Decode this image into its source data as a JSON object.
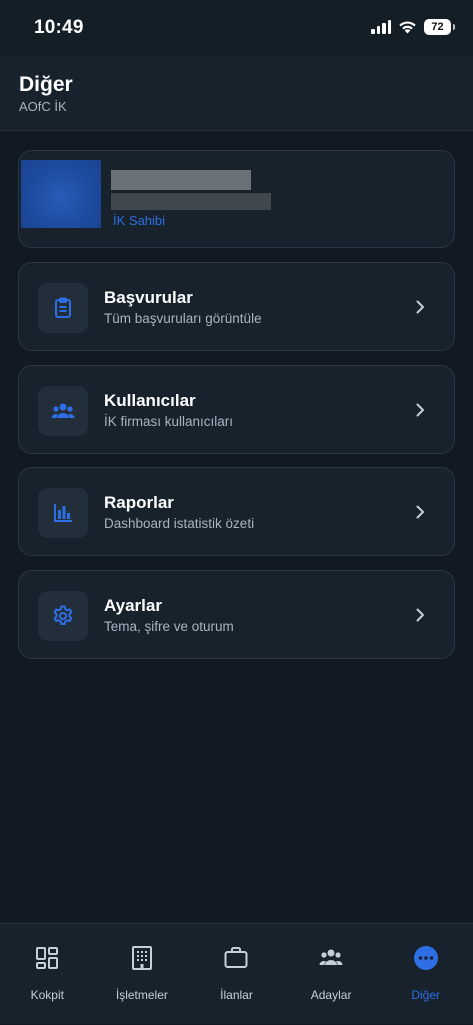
{
  "status_bar": {
    "time": "10:49",
    "battery": "72"
  },
  "header": {
    "title": "Diğer",
    "subtitle": "AOfC İK"
  },
  "profile": {
    "role": "İK Sahibi"
  },
  "menu": [
    {
      "title": "Başvurular",
      "desc": "Tüm başvuruları görüntüle",
      "icon": "clipboard-icon"
    },
    {
      "title": "Kullanıcılar",
      "desc": "İK firması kullanıcıları",
      "icon": "users-icon"
    },
    {
      "title": "Raporlar",
      "desc": "Dashboard istatistik özeti",
      "icon": "bar-chart-icon"
    },
    {
      "title": "Ayarlar",
      "desc": "Tema, şifre ve oturum",
      "icon": "gear-icon"
    }
  ],
  "tabs": [
    {
      "label": "Kokpit",
      "icon": "dashboard-icon"
    },
    {
      "label": "İşletmeler",
      "icon": "building-icon"
    },
    {
      "label": "İlanlar",
      "icon": "briefcase-icon"
    },
    {
      "label": "Adaylar",
      "icon": "people-icon"
    },
    {
      "label": "Diğer",
      "icon": "more-icon",
      "active": true
    }
  ],
  "colors": {
    "accent": "#2f6fe6",
    "background": "#111a22",
    "card": "#17222c"
  }
}
